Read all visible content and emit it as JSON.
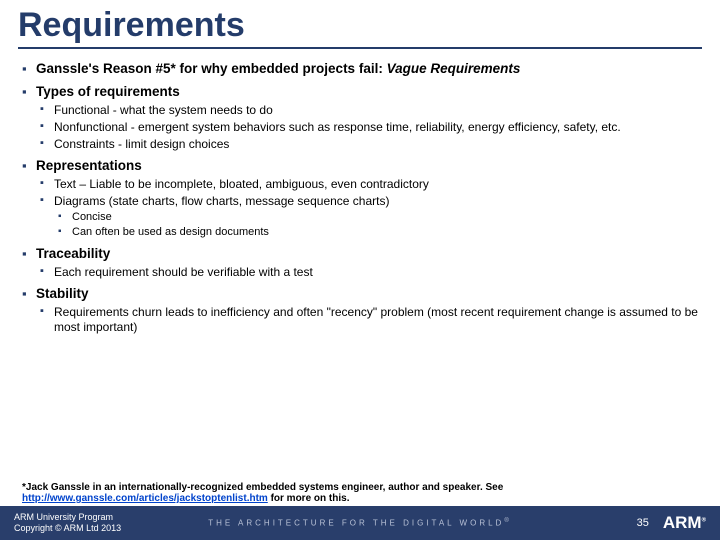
{
  "title": "Requirements",
  "b1": {
    "pre": "Ganssle's Reason #5* for why embedded projects fail: ",
    "em": "Vague Requirements"
  },
  "b2": {
    "h": "Types of requirements",
    "s": [
      "Functional - what the system needs to do",
      "Nonfunctional - emergent system behaviors such as response time, reliability, energy efficiency, safety, etc.",
      "Constraints - limit design choices"
    ]
  },
  "b3": {
    "h": "Representations",
    "s": [
      "Text – Liable to be incomplete, bloated, ambiguous, even contradictory",
      "Diagrams (state charts, flow charts, message sequence charts)"
    ],
    "ss": [
      "Concise",
      "Can often be used as design documents"
    ]
  },
  "b4": {
    "h": "Traceability",
    "s": [
      "Each requirement should be verifiable with a test"
    ]
  },
  "b5": {
    "h": "Stability",
    "s": [
      "Requirements churn leads to inefficiency and often \"recency\" problem (most recent requirement change is assumed to be most important)"
    ]
  },
  "footnote": {
    "pre": "*Jack Ganssle in an internationally-recognized embedded systems engineer, author and speaker. See ",
    "url": "http://www.ganssle.com/articles/jackstoptenlist.htm",
    "post": " for more on this."
  },
  "footer": {
    "program": "ARM University Program",
    "copyright": "Copyright © ARM Ltd 2013",
    "tagline": "THE ARCHITECTURE FOR THE DIGITAL WORLD",
    "page": "35",
    "logo": "ARM"
  }
}
